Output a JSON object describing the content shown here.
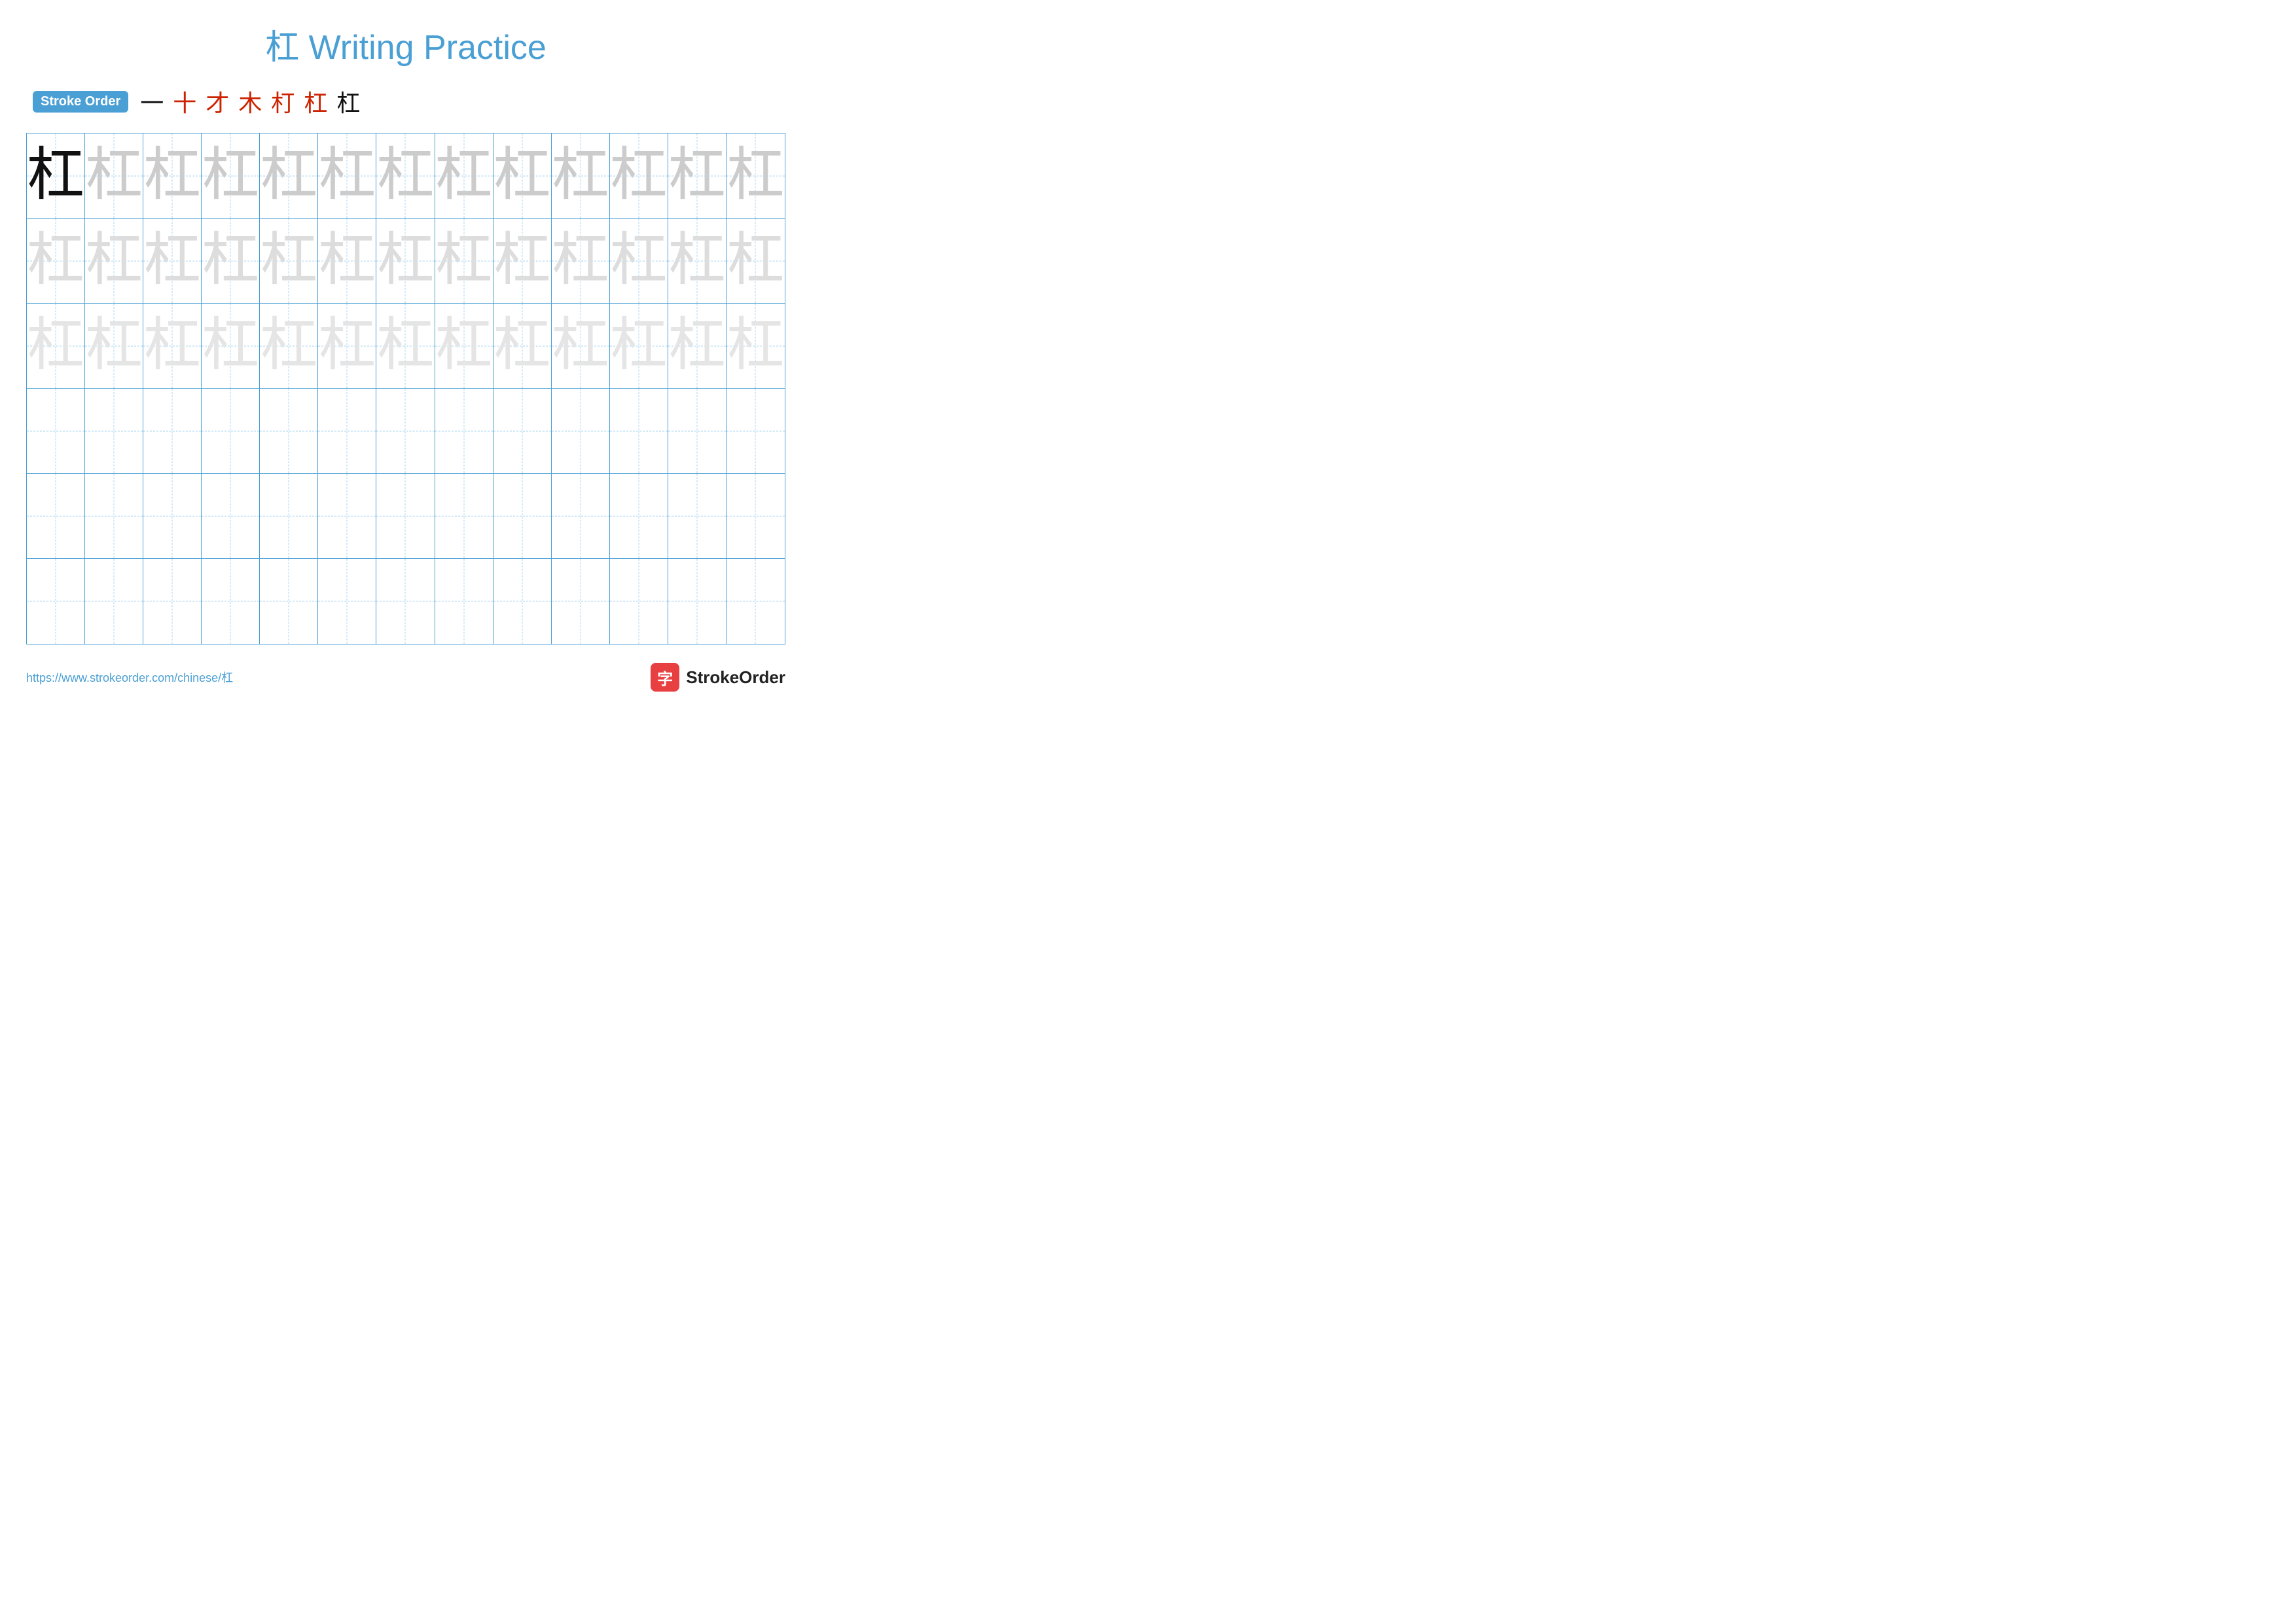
{
  "title": {
    "character": "杠",
    "label": "Writing Practice",
    "full": "杠 Writing Practice"
  },
  "stroke_order": {
    "badge": "Stroke Order",
    "strokes": [
      "一",
      "十",
      "才",
      "木",
      "朾",
      "杠̄",
      "杠"
    ]
  },
  "grid": {
    "rows": 6,
    "cols": 13,
    "character": "杠",
    "row_styles": [
      "dark",
      "light",
      "lighter",
      "empty",
      "empty",
      "empty"
    ]
  },
  "footer": {
    "url": "https://www.strokeorder.com/chinese/杠",
    "logo_icon": "字",
    "logo_text": "StrokeOrder"
  }
}
